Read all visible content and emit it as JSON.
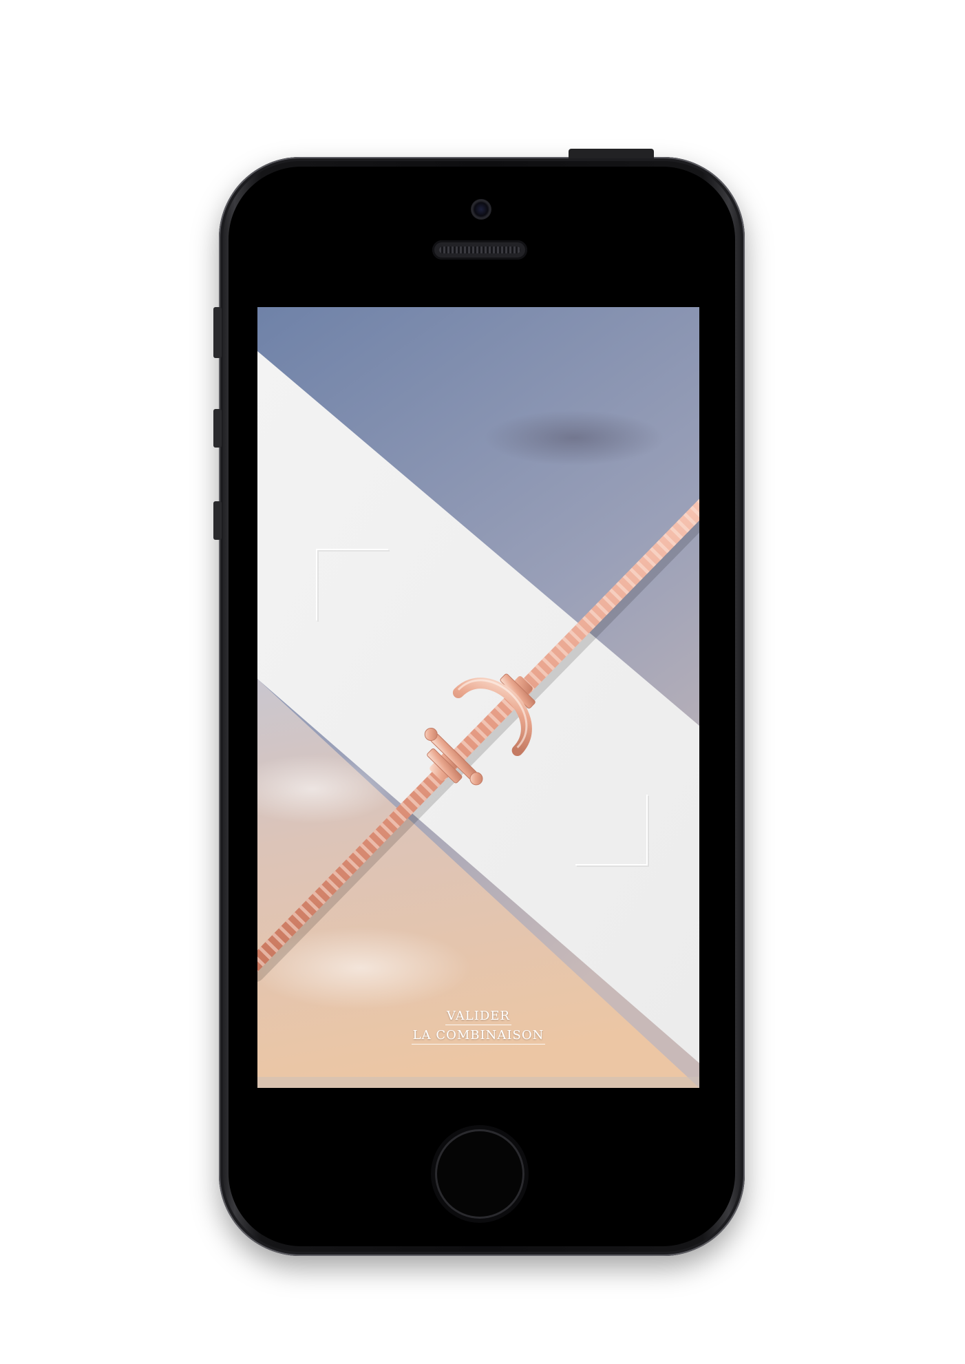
{
  "screen": {
    "cta_line1": "VALIDER",
    "cta_line2": "LA COMBINAISON"
  },
  "colors": {
    "phone_body": "#0e0e10",
    "sky_top": "#6f82a8",
    "sky_bottom": "#e8c3a2",
    "band": "#f1f1f1",
    "rose_gold": "#e9a58f"
  },
  "icons": [
    "camera-icon",
    "speaker-icon",
    "home-button-icon",
    "corner-frame-icon",
    "bracelet-clasp-icon"
  ]
}
